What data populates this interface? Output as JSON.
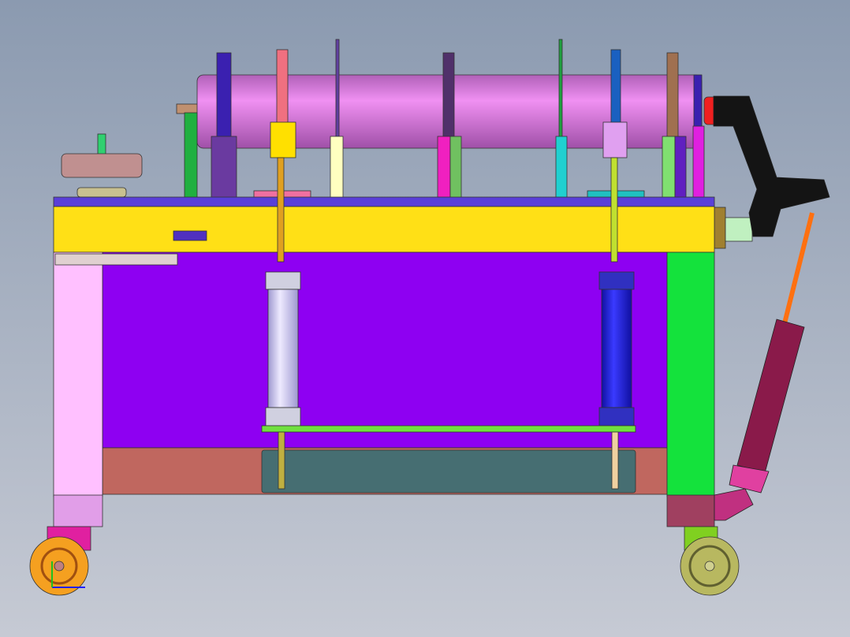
{
  "view": {
    "background_top": "#8b9ab0",
    "background_bottom": "#c6cad4"
  },
  "colors": {
    "roller": "#e07ee2",
    "top_plate": "#5a3fd8",
    "beam": "#ffe016",
    "panel": "#8e00f2",
    "lower_beam": "#c0675f",
    "lower_plate": "#466e72",
    "left_leg": "#ffc0ff",
    "right_leg": "#14e23c",
    "left_cylinder": "#c9c4f0",
    "right_cylinder": "#2222e0",
    "handle": "#141414",
    "angled_cylinder": "#8a1a4a",
    "left_wheel": "#f5a020",
    "right_wheel": "#b8b860"
  }
}
